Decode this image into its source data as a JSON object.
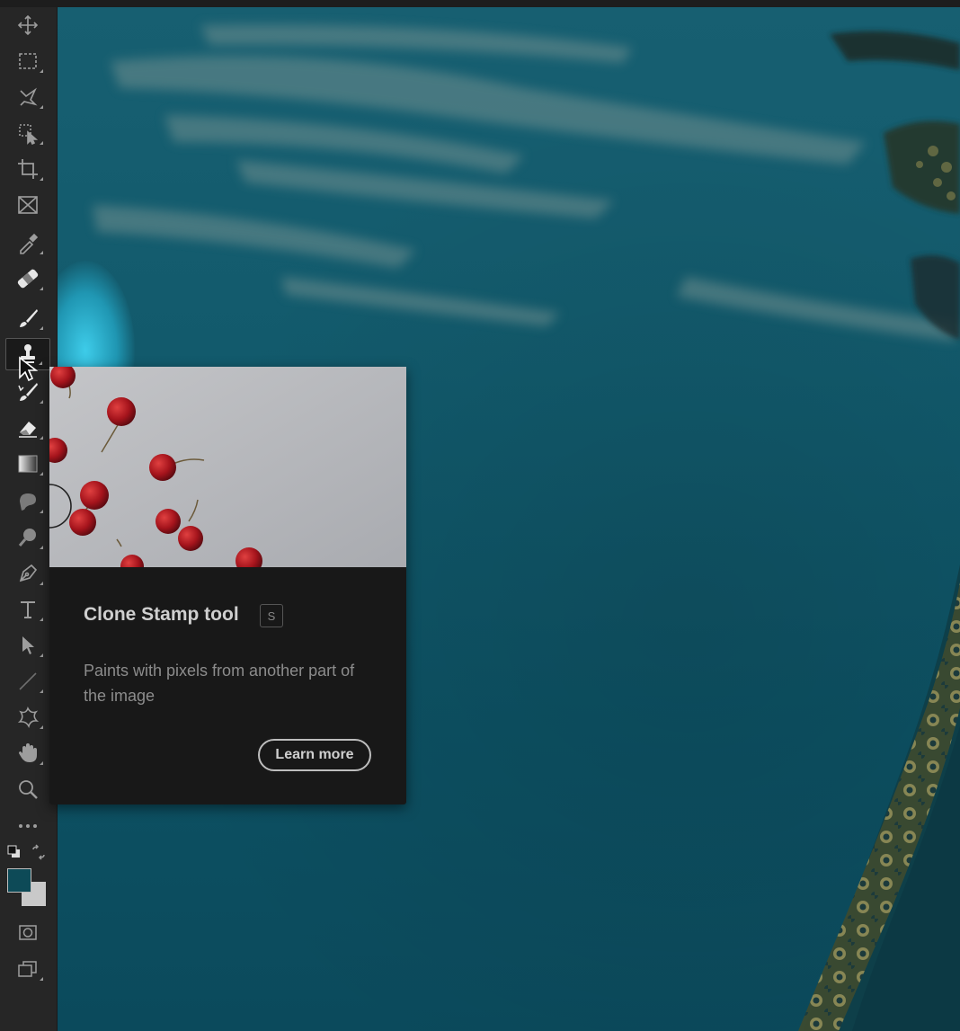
{
  "tooltip": {
    "title": "Clone Stamp tool",
    "shortcut": "S",
    "description": "Paints with pixels from another part of the image",
    "learn_more": "Learn more"
  },
  "toolbar": {
    "tools": [
      {
        "name": "move-tool",
        "icon": "move-icon"
      },
      {
        "name": "rectangular-marquee-tool",
        "icon": "marquee-icon"
      },
      {
        "name": "lasso-tool",
        "icon": "lasso-icon"
      },
      {
        "name": "object-selection-tool",
        "icon": "object-selection-icon"
      },
      {
        "name": "crop-tool",
        "icon": "crop-icon"
      },
      {
        "name": "frame-tool",
        "icon": "frame-icon"
      },
      {
        "name": "eyedropper-tool",
        "icon": "eyedropper-icon"
      },
      {
        "name": "healing-brush-tool",
        "icon": "bandage-icon"
      },
      {
        "name": "brush-tool",
        "icon": "brush-icon"
      },
      {
        "name": "clone-stamp-tool",
        "icon": "stamp-icon",
        "active": true
      },
      {
        "name": "history-brush-tool",
        "icon": "history-brush-icon"
      },
      {
        "name": "eraser-tool",
        "icon": "eraser-icon"
      },
      {
        "name": "gradient-tool",
        "icon": "gradient-icon"
      },
      {
        "name": "blur-tool",
        "icon": "blur-icon"
      },
      {
        "name": "dodge-tool",
        "icon": "dodge-icon"
      },
      {
        "name": "pen-tool",
        "icon": "pen-icon"
      },
      {
        "name": "type-tool",
        "icon": "type-icon"
      },
      {
        "name": "path-selection-tool",
        "icon": "arrow-icon"
      },
      {
        "name": "line-tool",
        "icon": "line-icon"
      },
      {
        "name": "custom-shape-tool",
        "icon": "shape-icon"
      },
      {
        "name": "hand-tool",
        "icon": "hand-icon"
      },
      {
        "name": "zoom-tool",
        "icon": "zoom-icon"
      },
      {
        "name": "edit-toolbar",
        "icon": "more-icon"
      }
    ],
    "foreground_color": "#0d4a57",
    "background_color": "#c8c8c8"
  }
}
